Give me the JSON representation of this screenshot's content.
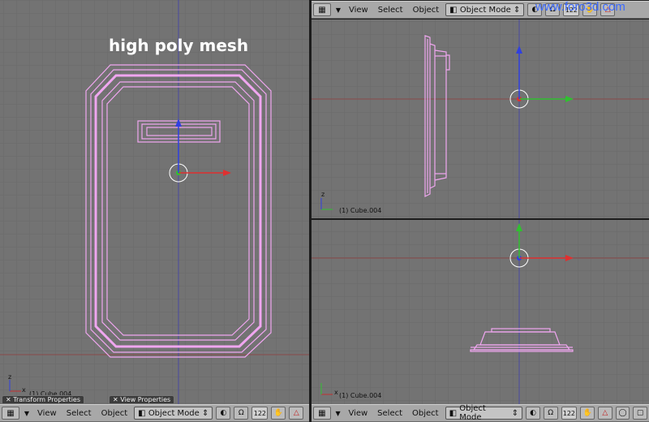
{
  "overlay_title": "high poly mesh",
  "watermark": "www.foro3d.com",
  "object_label": "(1) Cube.004",
  "menus": {
    "view": "View",
    "select": "Select",
    "object": "Object"
  },
  "mode": "Object Mode",
  "num_field": "122",
  "panel_tabs": {
    "transform": "Transform Properties",
    "view": "View Properties"
  },
  "axis_letters": {
    "x": "x",
    "z": "z"
  },
  "colors": {
    "viewport_bg": "#737373",
    "mesh": "#f0a6f0",
    "header": "#a8a8a8",
    "x_axis": "#e03030",
    "y_axis": "#30c030",
    "z_axis": "#3040e0"
  }
}
